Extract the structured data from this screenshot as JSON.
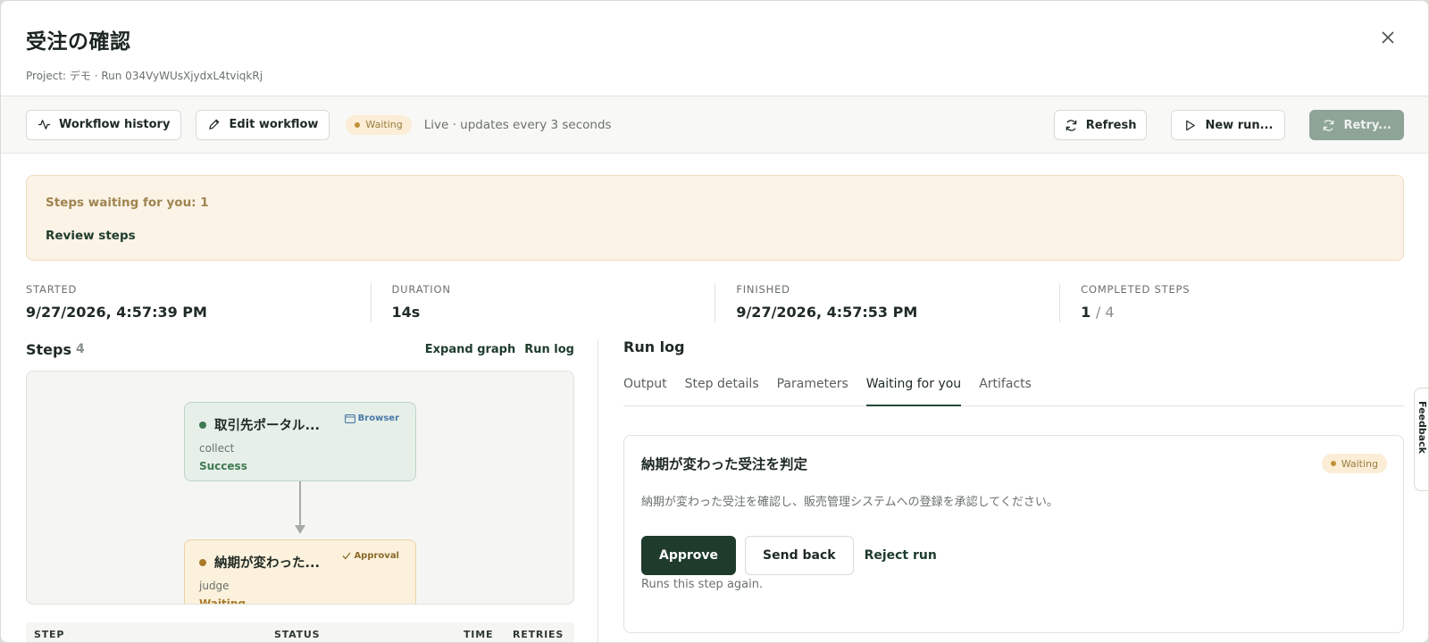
{
  "header": {
    "title": "受注の確認",
    "subtitle": "Project: デモ · Run 034VyWUsXjydxL4tviqkRj"
  },
  "toolbar": {
    "workflow_history": "Workflow history",
    "edit_workflow": "Edit workflow",
    "status_badge": "Waiting",
    "live_text": "Live · updates every 3 seconds",
    "refresh": "Refresh",
    "new_run": "New run...",
    "retry": "Retry..."
  },
  "alert": {
    "title": "Steps waiting for you: 1",
    "link": "Review steps"
  },
  "stats": {
    "started_label": "STARTED",
    "started_value": "9/27/2026, 4:57:39 PM",
    "duration_label": "DURATION",
    "duration_value": "14s",
    "finished_label": "FINISHED",
    "finished_value": "9/27/2026, 4:57:53 PM",
    "completed_label": "COMPLETED STEPS",
    "completed_value": "1",
    "completed_total": "/ 4"
  },
  "steps": {
    "title": "Steps",
    "count": "4",
    "expand_graph": "Expand graph",
    "run_log": "Run log",
    "nodes": [
      {
        "title": "取引先ポータル...",
        "kind": "collect",
        "status": "Success",
        "tag": "Browser",
        "dot_color": "#3f7a52",
        "status_color": "#3f7a52",
        "tag_color": "#4a78a8"
      },
      {
        "title": "納期が変わった...",
        "kind": "judge",
        "status": "Waiting",
        "tag": "Approval",
        "dot_color": "#a87a2a",
        "status_color": "#a87a2a",
        "tag_color": "#8a6a2a"
      }
    ],
    "table_headers": [
      "STEP",
      "STATUS",
      "TIME",
      "RETRIES"
    ]
  },
  "runlog": {
    "title": "Run log",
    "tabs": [
      "Output",
      "Step details",
      "Parameters",
      "Waiting for you",
      "Artifacts"
    ],
    "active_tab": "Waiting for you",
    "card": {
      "title": "納期が変わった受注を判定",
      "badge": "Waiting",
      "description": "納期が変わった受注を確認し、販売管理システムへの登録を承認してください。",
      "approve": "Approve",
      "send_back": "Send back",
      "reject": "Reject run",
      "hint": "Runs this step again."
    }
  },
  "feedback": {
    "label": "Feedback"
  }
}
